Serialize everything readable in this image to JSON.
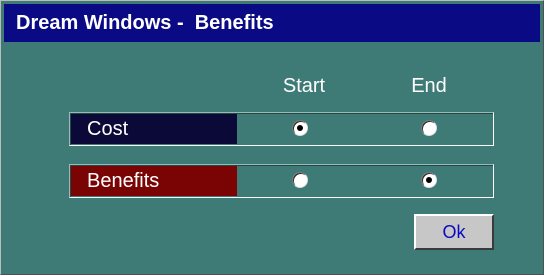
{
  "window": {
    "title": "Dream Windows -  Benefits"
  },
  "columns": {
    "start": "Start",
    "end": "End"
  },
  "rows": [
    {
      "label": "Cost",
      "selected": "start",
      "label_color": "#0b0937"
    },
    {
      "label": "Benefits",
      "selected": "end",
      "label_color": "#7a0404"
    }
  ],
  "buttons": {
    "ok_label": "Ok"
  },
  "colors": {
    "background": "#3e7b77",
    "titlebar": "#0b0a85",
    "ok_text": "#0a0ac0"
  }
}
